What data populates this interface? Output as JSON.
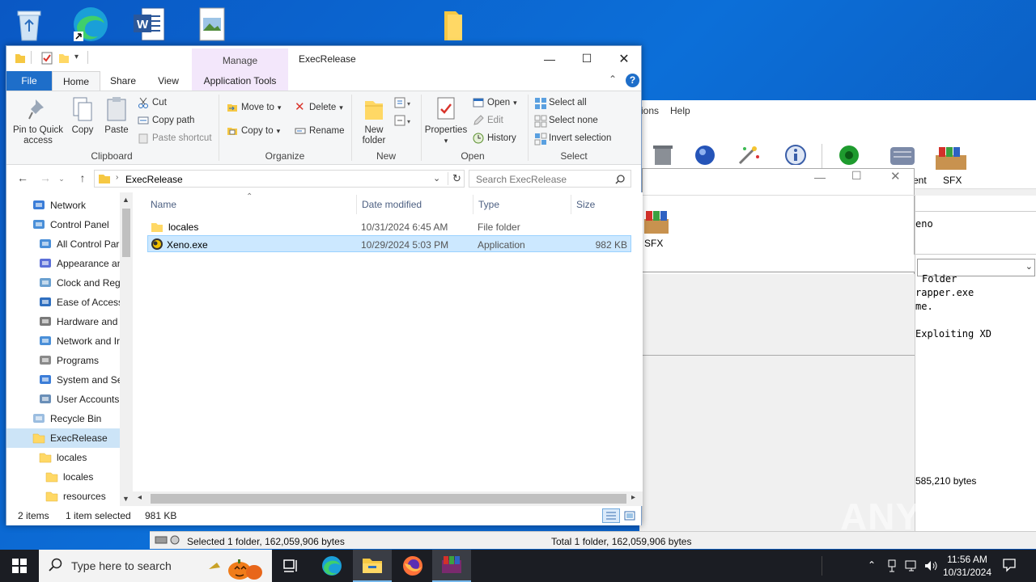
{
  "desktop": {
    "icons": [
      "recycle-bin",
      "edge",
      "word",
      "image-file",
      "folder"
    ]
  },
  "background_window": {
    "menu_items": [
      "ions",
      "Help"
    ],
    "toolbar_labels": [
      "ent",
      "SFX"
    ],
    "inner_label": "SFX",
    "text_lines": [
      "eno",
      "Folder",
      "rapper.exe",
      "me.",
      "Exploiting XD"
    ],
    "bytes_label": "585,210 bytes",
    "status_left": "Selected 1 folder, 162,059,906 bytes",
    "status_right": "Total 1 folder, 162,059,906 bytes"
  },
  "explorer": {
    "manage_tab": "Manage",
    "title": "ExecRelease",
    "tabs": {
      "file": "File",
      "home": "Home",
      "share": "Share",
      "view": "View",
      "app_tools": "Application Tools"
    },
    "ribbon": {
      "clipboard": {
        "pin": "Pin to Quick access",
        "copy": "Copy",
        "paste": "Paste",
        "cut": "Cut",
        "copy_path": "Copy path",
        "paste_shortcut": "Paste shortcut",
        "label": "Clipboard"
      },
      "organize": {
        "move_to": "Move to",
        "copy_to": "Copy to",
        "delete": "Delete",
        "rename": "Rename",
        "label": "Organize"
      },
      "new": {
        "new_folder": "New folder",
        "label": "New"
      },
      "open": {
        "properties": "Properties",
        "open": "Open",
        "edit": "Edit",
        "history": "History",
        "label": "Open"
      },
      "select": {
        "select_all": "Select all",
        "select_none": "Select none",
        "invert": "Invert selection",
        "label": "Select"
      }
    },
    "address": {
      "path": "ExecRelease",
      "search_placeholder": "Search ExecRelease"
    },
    "nav": [
      {
        "label": "Network",
        "icon": "network-icon",
        "indent": 0
      },
      {
        "label": "Control Panel",
        "icon": "control-panel-icon",
        "indent": 0
      },
      {
        "label": "All Control Par",
        "icon": "control-panel-icon",
        "indent": 1
      },
      {
        "label": "Appearance an",
        "icon": "appearance-icon",
        "indent": 1
      },
      {
        "label": "Clock and Regi",
        "icon": "clock-icon",
        "indent": 1
      },
      {
        "label": "Ease of Access",
        "icon": "ease-access-icon",
        "indent": 1
      },
      {
        "label": "Hardware and",
        "icon": "hardware-icon",
        "indent": 1
      },
      {
        "label": "Network and Ir",
        "icon": "network-internet-icon",
        "indent": 1
      },
      {
        "label": "Programs",
        "icon": "programs-icon",
        "indent": 1
      },
      {
        "label": "System and Se",
        "icon": "system-security-icon",
        "indent": 1
      },
      {
        "label": "User Accounts",
        "icon": "user-accounts-icon",
        "indent": 1
      },
      {
        "label": "Recycle Bin",
        "icon": "recycle-bin-icon",
        "indent": 0
      },
      {
        "label": "ExecRelease",
        "icon": "folder-icon",
        "indent": 0,
        "selected": true
      },
      {
        "label": "locales",
        "icon": "folder-icon",
        "indent": 1
      },
      {
        "label": "locales",
        "icon": "folder-icon",
        "indent": 2
      },
      {
        "label": "resources",
        "icon": "folder-icon",
        "indent": 2
      }
    ],
    "columns": {
      "name": "Name",
      "date": "Date modified",
      "type": "Type",
      "size": "Size"
    },
    "files": [
      {
        "name": "locales",
        "date": "10/31/2024 6:45 AM",
        "type": "File folder",
        "size": ""
      },
      {
        "name": "Xeno.exe",
        "date": "10/29/2024 5:03 PM",
        "type": "Application",
        "size": "982 KB",
        "selected": true
      }
    ],
    "status": {
      "items": "2 items",
      "selected": "1 item selected",
      "size": "981 KB"
    }
  },
  "taskbar": {
    "search_placeholder": "Type here to search",
    "time": "11:56 AM",
    "date": "10/31/2024"
  },
  "watermark": "ANY RUN"
}
